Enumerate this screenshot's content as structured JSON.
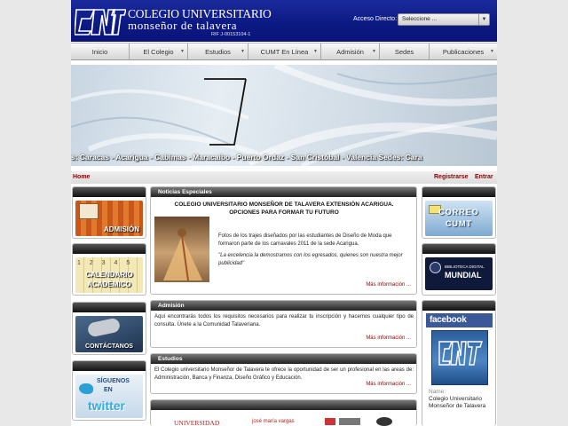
{
  "header": {
    "logo_line1": "COLEGIO UNIVERSITARIO",
    "logo_line2": "monseñor de talavera",
    "rif": "RIF J-00153104-1",
    "acceso_label": "Acceso Directo:",
    "acceso_value": "Seleccione ..."
  },
  "nav": {
    "items": [
      {
        "label": "Inicio"
      },
      {
        "label": "El Colegio"
      },
      {
        "label": "Estudios"
      },
      {
        "label": "CUMT En Línea"
      },
      {
        "label": "Admisión"
      },
      {
        "label": "Sedes"
      },
      {
        "label": "Publicaciones"
      }
    ]
  },
  "banner": {
    "ticker": "s: Caracas - Acarigua - Cabimas - Maracaibo - Puerto Ordaz - San Cristóbal - Valencia     Sedes: Cara"
  },
  "crumbbar": {
    "home": "Home",
    "registrarse": "Registrarse",
    "entrar": "Entrar"
  },
  "left_tiles": {
    "admision": "ADMISIÓN",
    "calendario1": "CALENDARIO",
    "calendario2": "ACADÉMICO",
    "contactanos": "CONTÁCTANOS",
    "siguenos1": "SÍGUENOS",
    "siguenos2": "EN",
    "twitter": "twitter"
  },
  "noticias": {
    "header": "Noticias Especiales",
    "title": "COLEGIO UNIVERSITARIO MONSEÑOR DE TALAVERA EXTENSIÓN ACARIGUA. OPCIONES PARA FORMAR TU FUTURO",
    "body": "Fotos de los trajes diseñados por las estudiantes de Diseño de Moda que formaron parte de los carnavales 2011 de la sede Acarigua.",
    "quote": "\"La excelencia la demostramos con los egresados, quienes son nuestra mejor publicidad\"",
    "more": "Más información ..."
  },
  "admision": {
    "header": "Admisión",
    "body": "Aquí encontrarás todos los requisitos necesarios para realizar tu inscripción y hacemos cualquier tipo de consulta. Únete a la Comunidad Talaveriana.",
    "more": "Más información ..."
  },
  "estudios": {
    "header": "Estudios",
    "body": "El Colegio universitario Monseñor de Talavera te ofrece la oportunidad de ser un profesional en las areas de: Administración, Banca y Finanza, Diseño Gráfico y Educación.",
    "more": "Más información ..."
  },
  "partners": {
    "p1": "UNIVERSIDAD",
    "p2": "josé maría vargas"
  },
  "right_tiles": {
    "correo1": "CORREO",
    "correo2": "CUMT",
    "biblioteca1": "BIBLIOTECA DIGITAL",
    "biblioteca2": "MUNDIAL"
  },
  "facebook": {
    "brand": "facebook",
    "name_label": "Name:",
    "name_value": "Colegio Universitario Monseñor de Talavera"
  },
  "colors": {
    "header_blue": "#0c1a84",
    "link_red": "#8b0000",
    "facebook_blue": "#3b5998"
  }
}
